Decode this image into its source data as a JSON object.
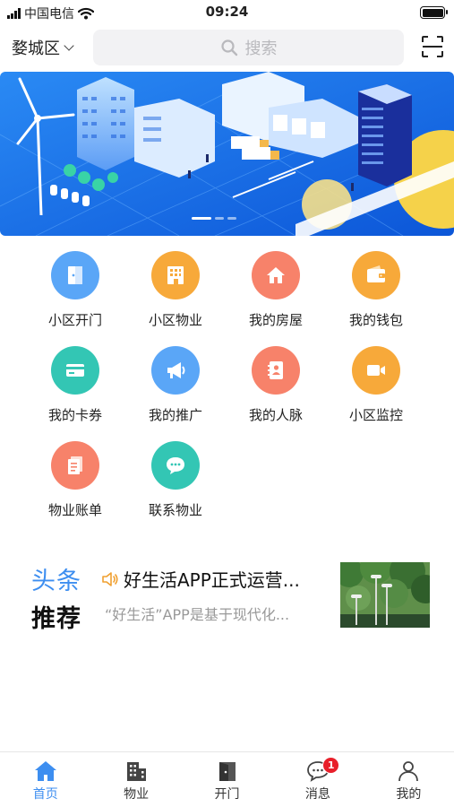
{
  "status_bar": {
    "carrier": "中国电信",
    "time": "09:24"
  },
  "header": {
    "city": "婺城区",
    "search_placeholder": "搜索"
  },
  "banner": {
    "page_count": 3,
    "active_page": 1
  },
  "grid": [
    {
      "label": "小区开门",
      "icon": "door-icon",
      "color": "#5aa6f7"
    },
    {
      "label": "小区物业",
      "icon": "building-icon",
      "color": "#f7a93a"
    },
    {
      "label": "我的房屋",
      "icon": "house-icon",
      "color": "#f7826a"
    },
    {
      "label": "我的钱包",
      "icon": "wallet-icon",
      "color": "#f7a93a"
    },
    {
      "label": "我的卡券",
      "icon": "card-icon",
      "color": "#33c6b4"
    },
    {
      "label": "我的推广",
      "icon": "megaphone-icon",
      "color": "#5aa6f7"
    },
    {
      "label": "我的人脉",
      "icon": "contacts-icon",
      "color": "#f7826a"
    },
    {
      "label": "小区监控",
      "icon": "camera-icon",
      "color": "#f7a93a"
    },
    {
      "label": "物业账单",
      "icon": "bill-icon",
      "color": "#f7826a"
    },
    {
      "label": "联系物业",
      "icon": "chat-icon",
      "color": "#33c6b4"
    }
  ],
  "news": {
    "title_line1": "头条",
    "title_line2": "推荐",
    "headline": "好生活APP正式运营...",
    "summary": "“好生活”APP是基于现代化..."
  },
  "tabbar": {
    "items": [
      {
        "label": "首页",
        "icon": "home-icon",
        "active": true
      },
      {
        "label": "物业",
        "icon": "building-icon",
        "active": false
      },
      {
        "label": "开门",
        "icon": "door-icon",
        "active": false
      },
      {
        "label": "消息",
        "icon": "message-icon",
        "active": false,
        "badge": "1"
      },
      {
        "label": "我的",
        "icon": "person-icon",
        "active": false
      }
    ]
  },
  "colors": {
    "accent": "#3d8ef0",
    "badge": "#e81f2a"
  }
}
